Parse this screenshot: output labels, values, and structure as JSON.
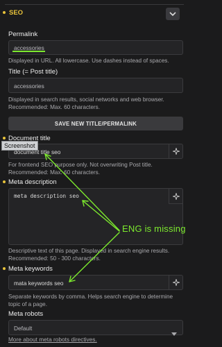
{
  "section": {
    "title": "SEO"
  },
  "permalink": {
    "label": "Permalink",
    "value": "accessories",
    "help": "Displayed in URL. All lowercase. Use dashes instead of spaces."
  },
  "title": {
    "label": "Title (= Post title)",
    "value": "accessories",
    "help": "Displayed in search results, social networks and web browser. Recommended: Max. 60 characters."
  },
  "save_button": {
    "label": "SAVE NEW TITLE/PERMALINK"
  },
  "document_title": {
    "label": "Document title",
    "value": "document title seo",
    "help": "For frontend SEO purpose only. Not overwriting Post title. Recommended: Max. 60 characters."
  },
  "tooltip": {
    "text": "Screenshot"
  },
  "meta_description": {
    "label": "Meta description",
    "value": "meta description seo",
    "help": "Descriptive text of this page. Displayed in search engine results. Recommended: 50 - 300 characters."
  },
  "meta_keywords": {
    "label": "Meta keywords",
    "value": "mata keywords seo",
    "help": "Separate keywords by comma. Helps search engine to determine topic of a page."
  },
  "meta_robots": {
    "label": "Meta robots",
    "selected": "Default"
  },
  "robots_link": {
    "label": "More about meta robots directives."
  },
  "annotation": {
    "text": "ENG is missing",
    "color": "#7dea2e"
  },
  "colors": {
    "accent": "#e8c33a",
    "background": "#1b1b1c",
    "field": "#242426"
  }
}
